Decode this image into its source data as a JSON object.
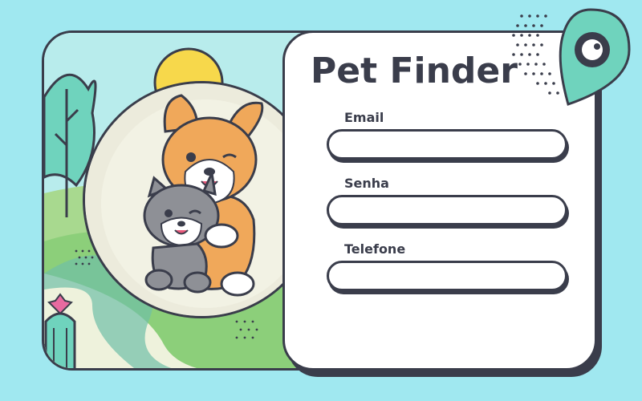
{
  "app": {
    "title": "Pet Finder"
  },
  "form": {
    "fields": [
      {
        "label": "Email",
        "value": "",
        "placeholder": ""
      },
      {
        "label": "Senha",
        "value": "",
        "placeholder": ""
      },
      {
        "label": "Telefone",
        "value": "",
        "placeholder": ""
      }
    ]
  },
  "icons": {
    "logo": "map-pin-icon",
    "hero": "dog-and-cat-illustration"
  },
  "colors": {
    "background": "#a0e8f0",
    "outline": "#3a3d4b",
    "accent_teal": "#6fd3bd",
    "sun": "#f7d84b",
    "corgi": "#f0a85a",
    "cat": "#8e9096"
  }
}
